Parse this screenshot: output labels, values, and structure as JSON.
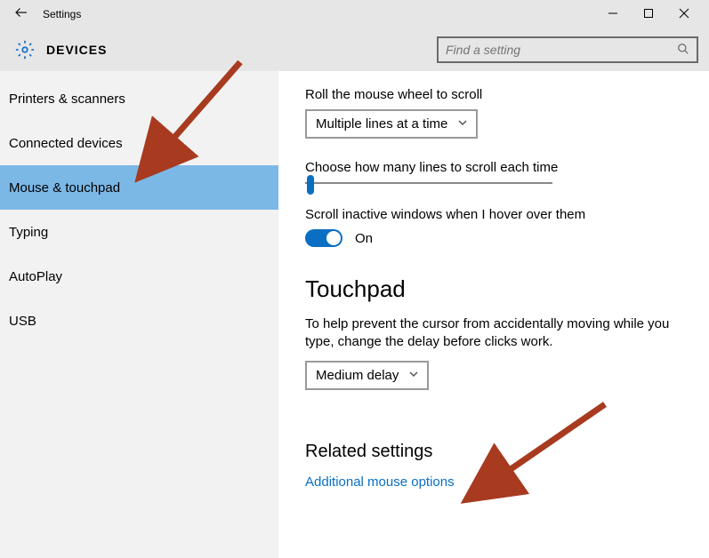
{
  "window": {
    "title": "Settings",
    "section": "DEVICES"
  },
  "search": {
    "placeholder": "Find a setting"
  },
  "sidebar": {
    "items": [
      {
        "label": "Printers & scanners",
        "selected": false
      },
      {
        "label": "Connected devices",
        "selected": false
      },
      {
        "label": "Mouse & touchpad",
        "selected": true
      },
      {
        "label": "Typing",
        "selected": false
      },
      {
        "label": "AutoPlay",
        "selected": false
      },
      {
        "label": "USB",
        "selected": false
      }
    ]
  },
  "main": {
    "scroll_label": "Roll the mouse wheel to scroll",
    "scroll_dropdown": "Multiple lines at a time",
    "lines_label": "Choose how many lines to scroll each time",
    "inactive_label": "Scroll inactive windows when I hover over them",
    "toggle_state": "On",
    "touchpad_heading": "Touchpad",
    "touchpad_desc": "To help prevent the cursor from accidentally moving while you type, change the delay before clicks work.",
    "delay_dropdown": "Medium delay",
    "related_heading": "Related settings",
    "related_link": "Additional mouse options"
  }
}
